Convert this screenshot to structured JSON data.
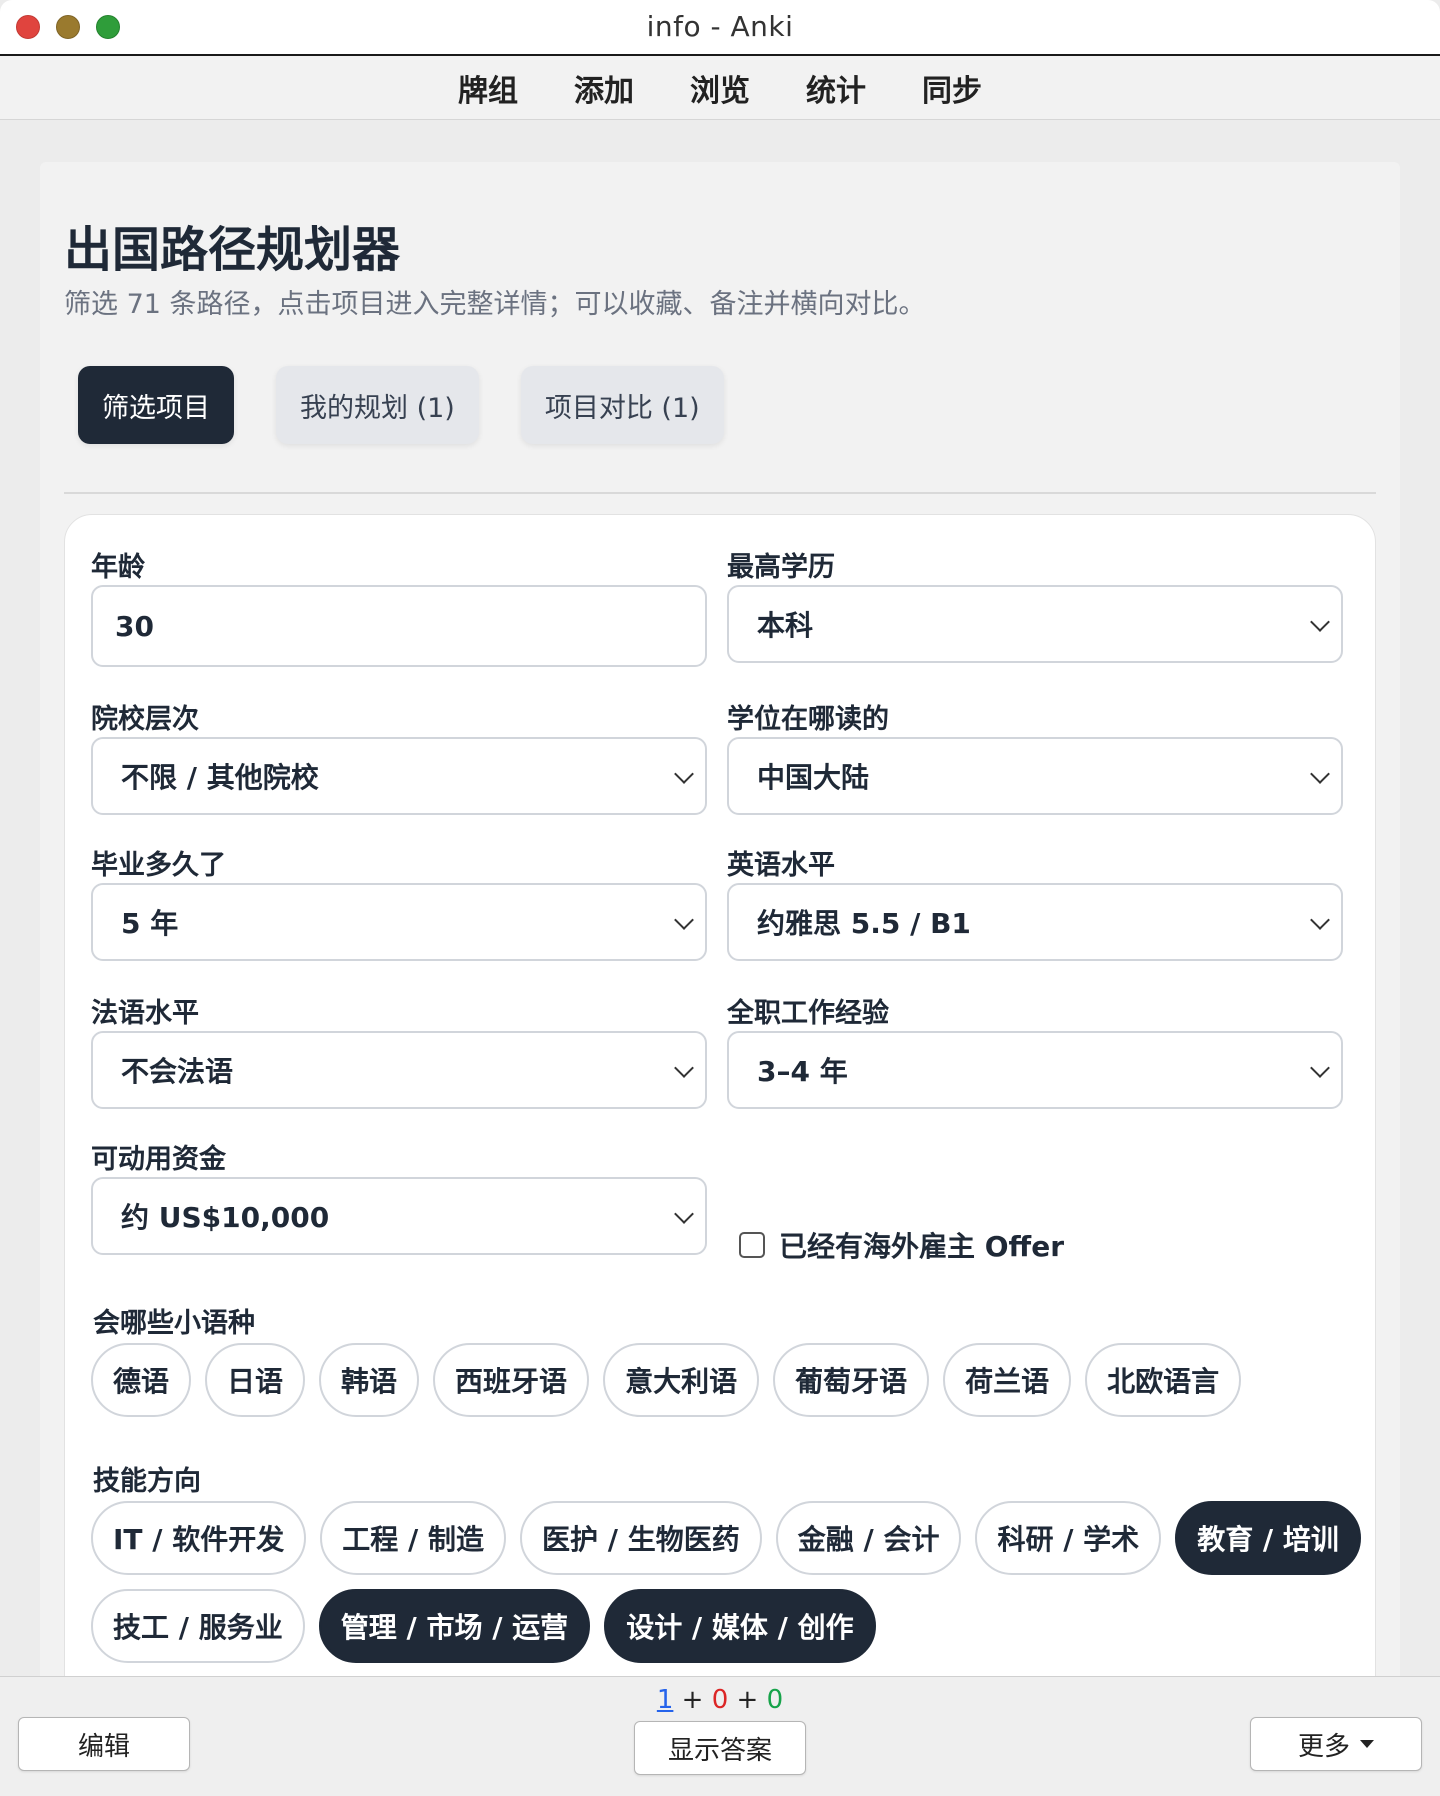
{
  "window": {
    "title": "info - Anki"
  },
  "topmenu": [
    "牌组",
    "添加",
    "浏览",
    "统计",
    "同步"
  ],
  "page": {
    "title": "出国路径规划器",
    "subtitle": "筛选 71 条路径，点击项目进入完整详情；可以收藏、备注并横向对比。"
  },
  "tabs": [
    "筛选项目",
    "我的规划 (1)",
    "项目对比 (1)"
  ],
  "form": {
    "age": {
      "label": "年龄",
      "value": "30"
    },
    "education": {
      "label": "最高学历",
      "value": "本科"
    },
    "school_level": {
      "label": "院校层次",
      "value": "不限 / 其他院校"
    },
    "degree_location": {
      "label": "学位在哪读的",
      "value": "中国大陆"
    },
    "years_since_grad": {
      "label": "毕业多久了",
      "value": "5 年"
    },
    "english": {
      "label": "英语水平",
      "value": "约雅思 5.5 / B1"
    },
    "french": {
      "label": "法语水平",
      "value": "不会法语"
    },
    "work_experience": {
      "label": "全职工作经验",
      "value": "3–4 年"
    },
    "funds": {
      "label": "可动用资金",
      "value": "约 US$10,000"
    },
    "offer_checkbox": {
      "label": "已经有海外雇主 Offer",
      "checked": false
    },
    "languages": {
      "label": "会哪些小语种",
      "options": [
        "德语",
        "日语",
        "韩语",
        "西班牙语",
        "意大利语",
        "葡萄牙语",
        "荷兰语",
        "北欧语言"
      ]
    },
    "skills": {
      "label": "技能方向",
      "options": [
        "IT / 软件开发",
        "工程 / 制造",
        "医护 / 生物医药",
        "金融 / 会计",
        "科研 / 学术",
        "教育 / 培训",
        "技工 / 服务业",
        "管理 / 市场 / 运营",
        "设计 / 媒体 / 创作"
      ],
      "selected": [
        "教育 / 培训",
        "管理 / 市场 / 运营",
        "设计 / 媒体 / 创作"
      ]
    }
  },
  "bottombar": {
    "count_new": "1",
    "count_learn": "0",
    "count_review": "0",
    "edit_label": "编辑",
    "show_answer_label": "显示答案",
    "more_label": "更多"
  }
}
